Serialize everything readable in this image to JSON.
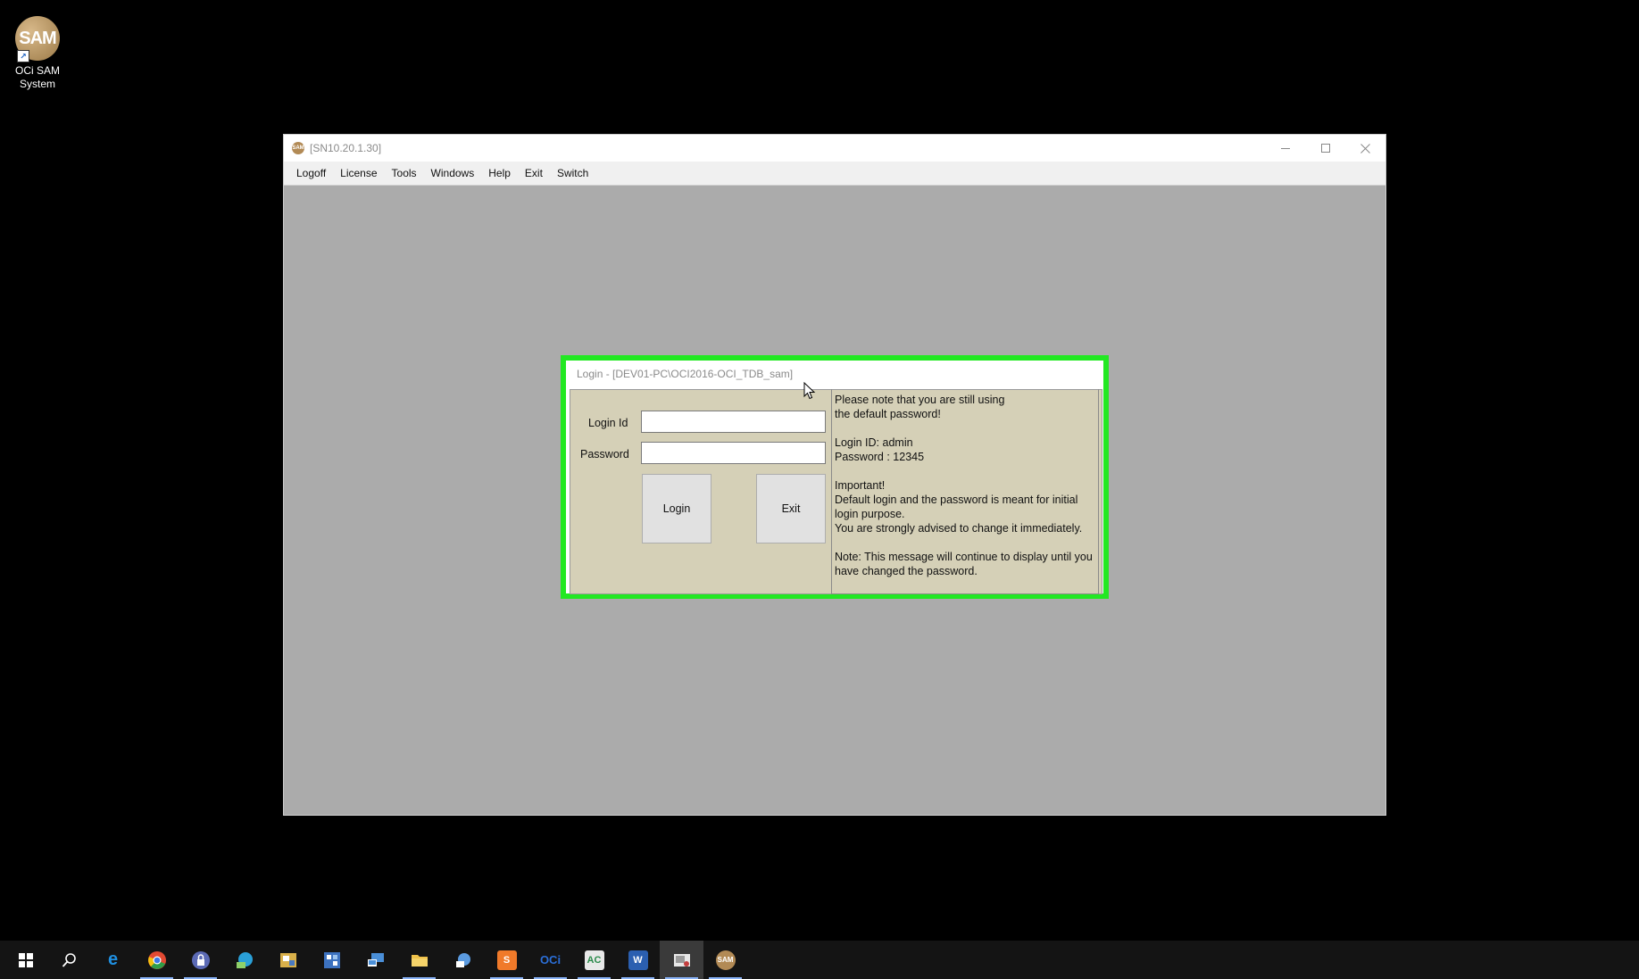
{
  "desktop": {
    "icon_logo_text": "SAM",
    "icon_label_line1": "OCi SAM",
    "icon_label_line2": "System"
  },
  "window": {
    "title": "[SN10.20.1.30]",
    "menu": [
      "Logoff",
      "License",
      "Tools",
      "Windows",
      "Help",
      "Exit",
      "Switch"
    ]
  },
  "login_dialog": {
    "title": "Login - [DEV01-PC\\OCI2016-OCI_TDB_sam]",
    "login_id_label": "Login Id",
    "password_label": "Password",
    "login_id_value": "",
    "password_value": "",
    "login_button": "Login",
    "exit_button": "Exit",
    "notice": {
      "line1": "Please note that you are still using",
      "line2": "the default password!",
      "cred1": "Login ID: admin",
      "cred2": "Password : 12345",
      "important": "Important!",
      "imp1": "Default login and the password is meant for initial login purpose.",
      "imp2": "You are strongly advised to change it immediately.",
      "note": "Note: This message will continue to display until you have changed the password."
    }
  },
  "taskbar": {
    "items": [
      {
        "icon": "windows-start-icon",
        "color": "#ffffff"
      },
      {
        "icon": "search-icon",
        "color": "#ffffff"
      },
      {
        "icon": "edge-icon",
        "color": "#1f8fe0"
      },
      {
        "icon": "chrome-icon",
        "color": "#e24a33"
      },
      {
        "icon": "keepass-icon",
        "color": "#5b6ab5"
      },
      {
        "icon": "network-icon",
        "color": "#2aa0d8"
      },
      {
        "icon": "explorer-tools-icon",
        "color": "#d9b04a"
      },
      {
        "icon": "network-monitor-icon",
        "color": "#3c72c0"
      },
      {
        "icon": "remote-desktop-icon",
        "color": "#4a8fd8"
      },
      {
        "icon": "file-explorer-icon",
        "color": "#f0c24a"
      },
      {
        "icon": "app-globe-icon",
        "color": "#5b9be0"
      },
      {
        "icon": "sublime-icon",
        "color": "#f07a2a"
      },
      {
        "icon": "oci-icon",
        "color": "#2b6fd8"
      },
      {
        "icon": "ac-icon",
        "color": "#2a8a4a"
      },
      {
        "icon": "word-icon",
        "color": "#2b5fb0"
      },
      {
        "icon": "snipping-icon",
        "color": "#c33d3d"
      },
      {
        "icon": "sam-icon",
        "color": "#b28a55"
      }
    ],
    "labels": {
      "oci": "OCi",
      "ac": "AC",
      "word": "W",
      "sam": "SAM"
    }
  }
}
